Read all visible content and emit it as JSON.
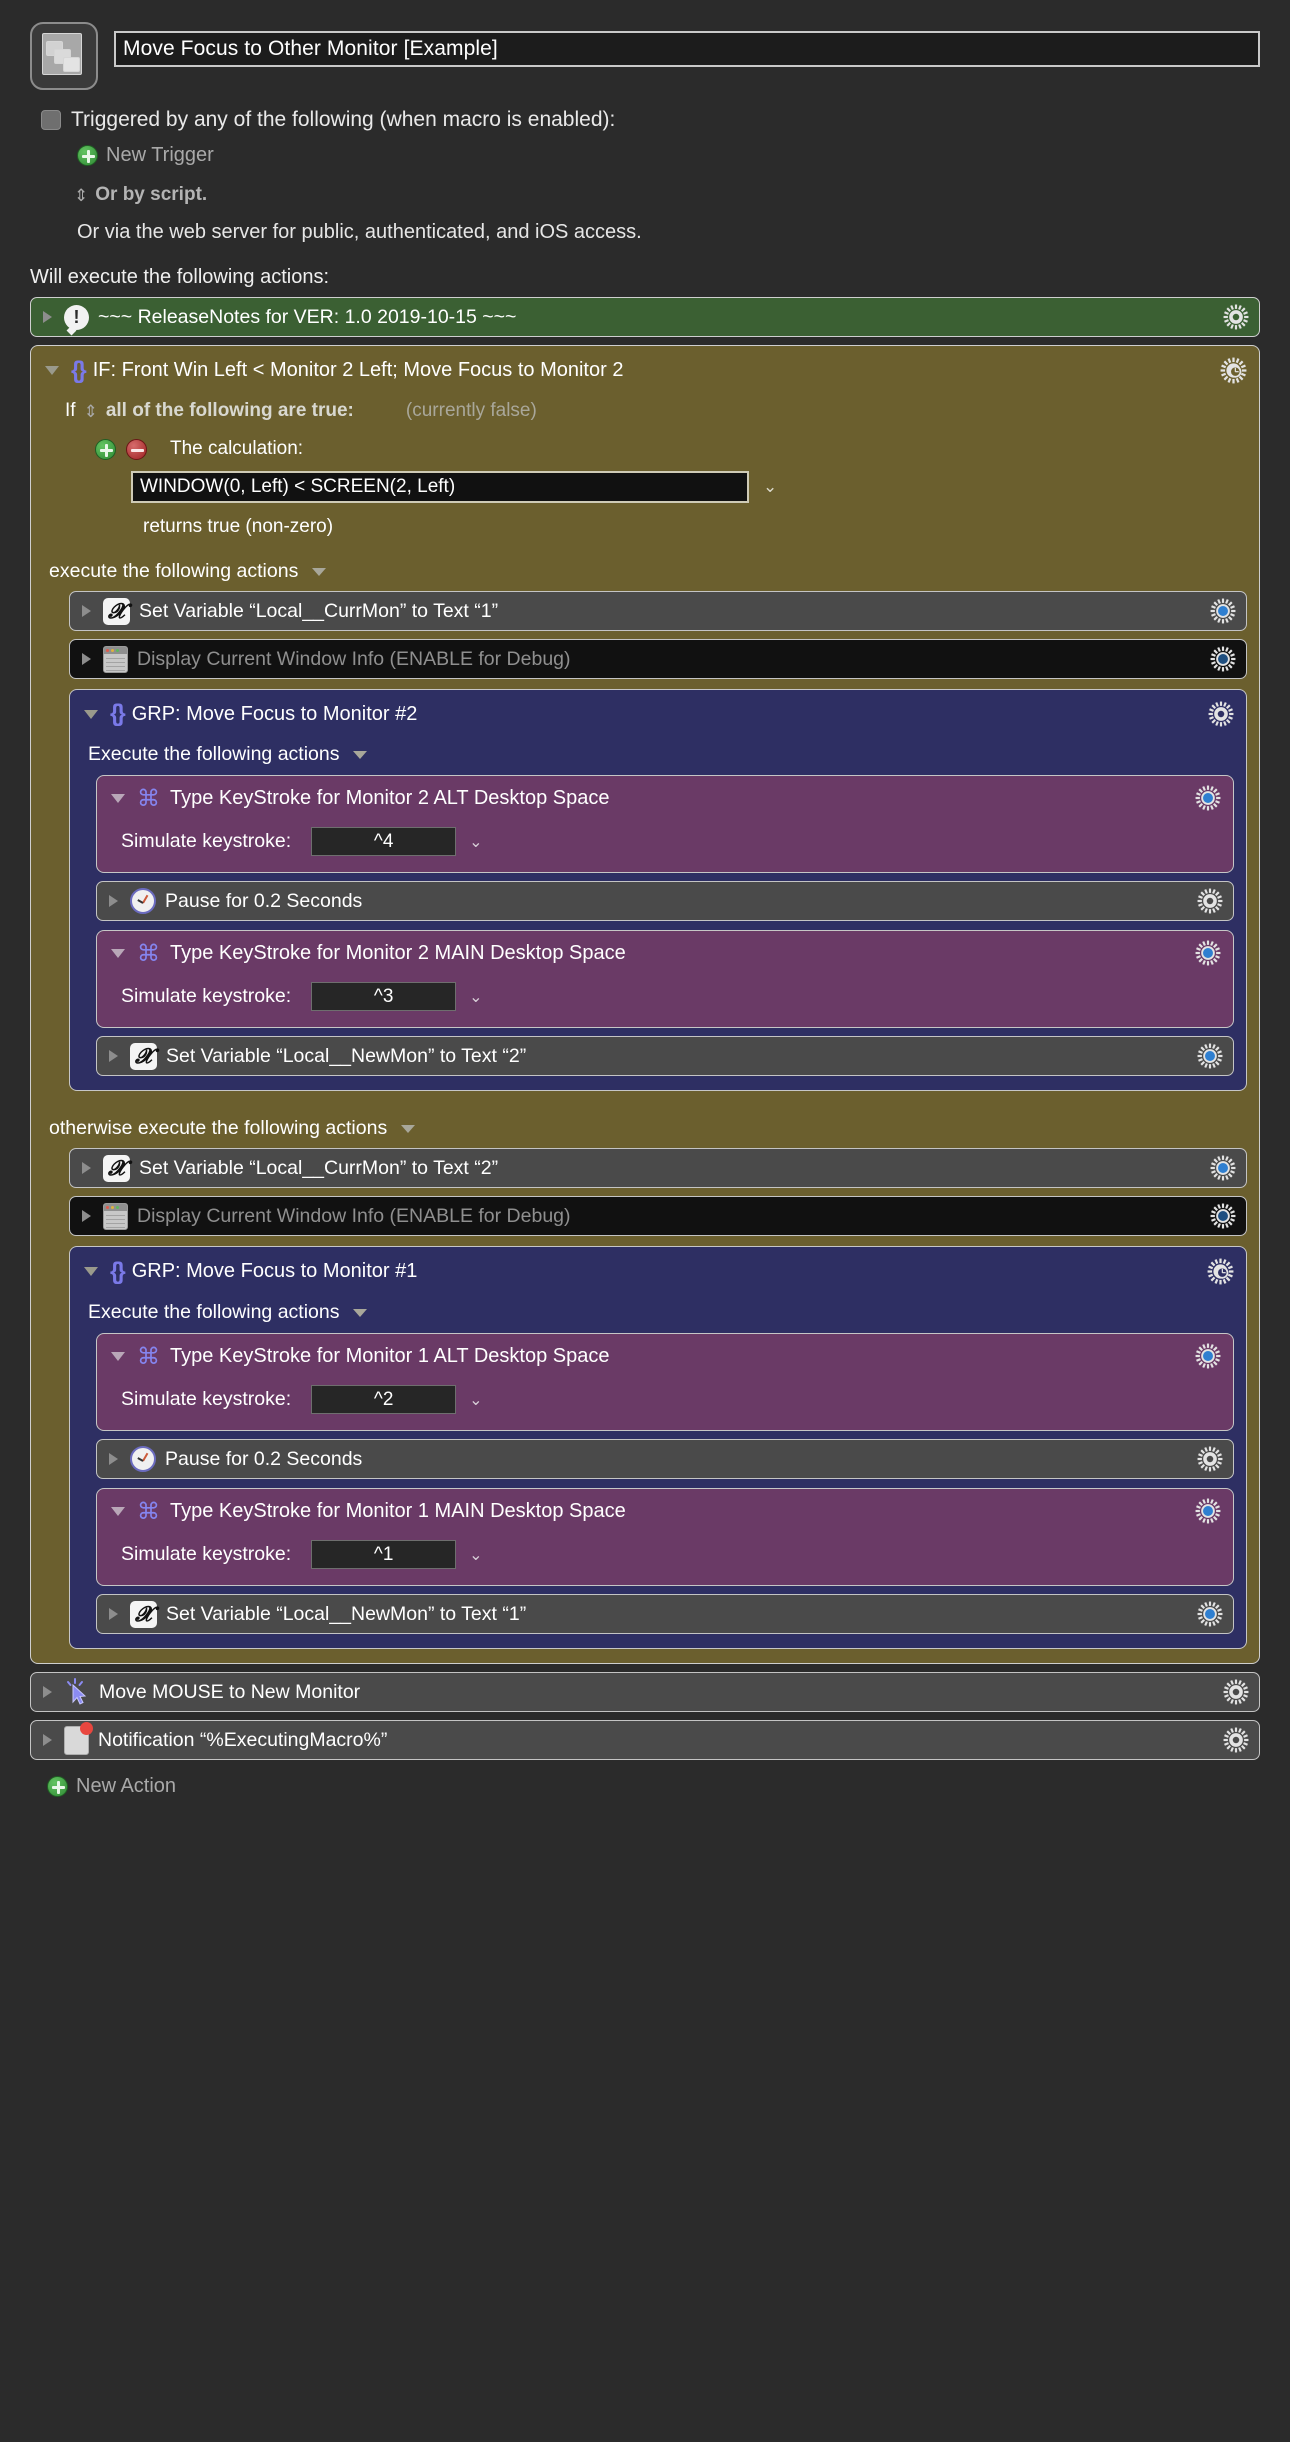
{
  "header": {
    "macro_icon": "windows-stack-icon",
    "macro_title": "Move Focus to Other Monitor [Example]",
    "trigger_checkbox_label": "Triggered by any of the following (when macro is enabled):",
    "new_trigger_label": "New Trigger",
    "or_by_script": "Or by script.",
    "web_server_line": "Or via the web server for public, authenticated, and iOS access.",
    "will_execute": "Will execute the following actions:"
  },
  "release_notes": {
    "title": "~~~ ReleaseNotes for  VER: 1.0    2019-10-15 ~~~",
    "icon": "comment-exclamation-icon",
    "gear": "gear-icon"
  },
  "if_block": {
    "title": "IF:  Front Win Left < Monitor 2 Left; Move Focus to Monitor 2",
    "icon": "braces-icon",
    "gear": "gear-clock-icon",
    "if_word": "If",
    "condition_mode": "all of the following are true:",
    "current_state": "(currently false)",
    "calculation_label": "The calculation:",
    "calculation_value": "WINDOW(0, Left) < SCREEN(2, Left)",
    "returns_label": "returns true (non-zero)",
    "then_label": "execute the following actions",
    "else_label": "otherwise execute the following actions",
    "add_condition": "add-condition-button",
    "remove_condition": "remove-condition-button"
  },
  "then_actions": [
    {
      "kind": "setvar",
      "title": "Set Variable “Local__CurrMon” to Text “1”",
      "icon": "variable-x-icon",
      "gear": "gear-blue-icon",
      "disabled": false
    },
    {
      "kind": "disabled",
      "title": "Display Current Window Info (ENABLE for Debug)",
      "icon": "window-info-icon",
      "gear": "gear-blue-icon",
      "disabled": true
    }
  ],
  "then_group": {
    "title": "GRP:  Move Focus to Monitor #2",
    "icon": "braces-icon",
    "gear": "gear-icon",
    "exec_label": "Execute the following actions",
    "children": [
      {
        "kind": "keystroke",
        "title": "Type KeyStroke for Monitor 2 ALT Desktop Space",
        "icon": "command-key-icon",
        "gear": "gear-blue-icon",
        "field_label": "Simulate keystroke:",
        "field_value": "^4"
      },
      {
        "kind": "pause",
        "title": "Pause for 0.2 Seconds",
        "icon": "clock-icon",
        "gear": "gear-icon"
      },
      {
        "kind": "keystroke",
        "title": "Type KeyStroke for Monitor 2 MAIN Desktop Space",
        "icon": "command-key-icon",
        "gear": "gear-blue-icon",
        "field_label": "Simulate keystroke:",
        "field_value": "^3"
      },
      {
        "kind": "setvar",
        "title": "Set Variable “Local__NewMon” to Text “2”",
        "icon": "variable-x-icon",
        "gear": "gear-blue-icon"
      }
    ]
  },
  "else_actions": [
    {
      "kind": "setvar",
      "title": "Set Variable “Local__CurrMon” to Text “2”",
      "icon": "variable-x-icon",
      "gear": "gear-blue-icon",
      "disabled": false
    },
    {
      "kind": "disabled",
      "title": "Display Current Window Info (ENABLE for Debug)",
      "icon": "window-info-icon",
      "gear": "gear-blue-icon",
      "disabled": true
    }
  ],
  "else_group": {
    "title": "GRP:  Move Focus to Monitor #1",
    "icon": "braces-icon",
    "gear": "gear-clock-icon",
    "exec_label": "Execute the following actions",
    "children": [
      {
        "kind": "keystroke",
        "title": "Type KeyStroke for Monitor 1 ALT Desktop Space",
        "icon": "command-key-icon",
        "gear": "gear-blue-icon",
        "field_label": "Simulate keystroke:",
        "field_value": "^2"
      },
      {
        "kind": "pause",
        "title": "Pause for 0.2 Seconds",
        "icon": "clock-icon",
        "gear": "gear-icon"
      },
      {
        "kind": "keystroke",
        "title": "Type KeyStroke for Monitor 1 MAIN Desktop Space",
        "icon": "command-key-icon",
        "gear": "gear-blue-icon",
        "field_label": "Simulate keystroke:",
        "field_value": "^1"
      },
      {
        "kind": "setvar",
        "title": "Set Variable “Local__NewMon” to Text “1”",
        "icon": "variable-x-icon",
        "gear": "gear-blue-icon"
      }
    ]
  },
  "tail_actions": [
    {
      "kind": "mouse",
      "title": "Move MOUSE to New Monitor",
      "icon": "mouse-pointer-icon",
      "gear": "gear-icon"
    },
    {
      "kind": "notification",
      "title": "Notification “%ExecutingMacro%”",
      "icon": "notification-badge-icon",
      "gear": "gear-icon"
    }
  ],
  "footer": {
    "new_action_label": "New Action"
  },
  "colors": {
    "background": "#2b2b2b",
    "release_notes_green": "#3b6033",
    "if_olive": "#6b5f2e",
    "group_blue": "#2e2f63",
    "keystroke_purple": "#6a3a66",
    "row_gray": "#4a4a4a",
    "row_disabled": "#111111",
    "accent_braces": "#7a79e8",
    "gear_blue": "#2f7fd0"
  }
}
